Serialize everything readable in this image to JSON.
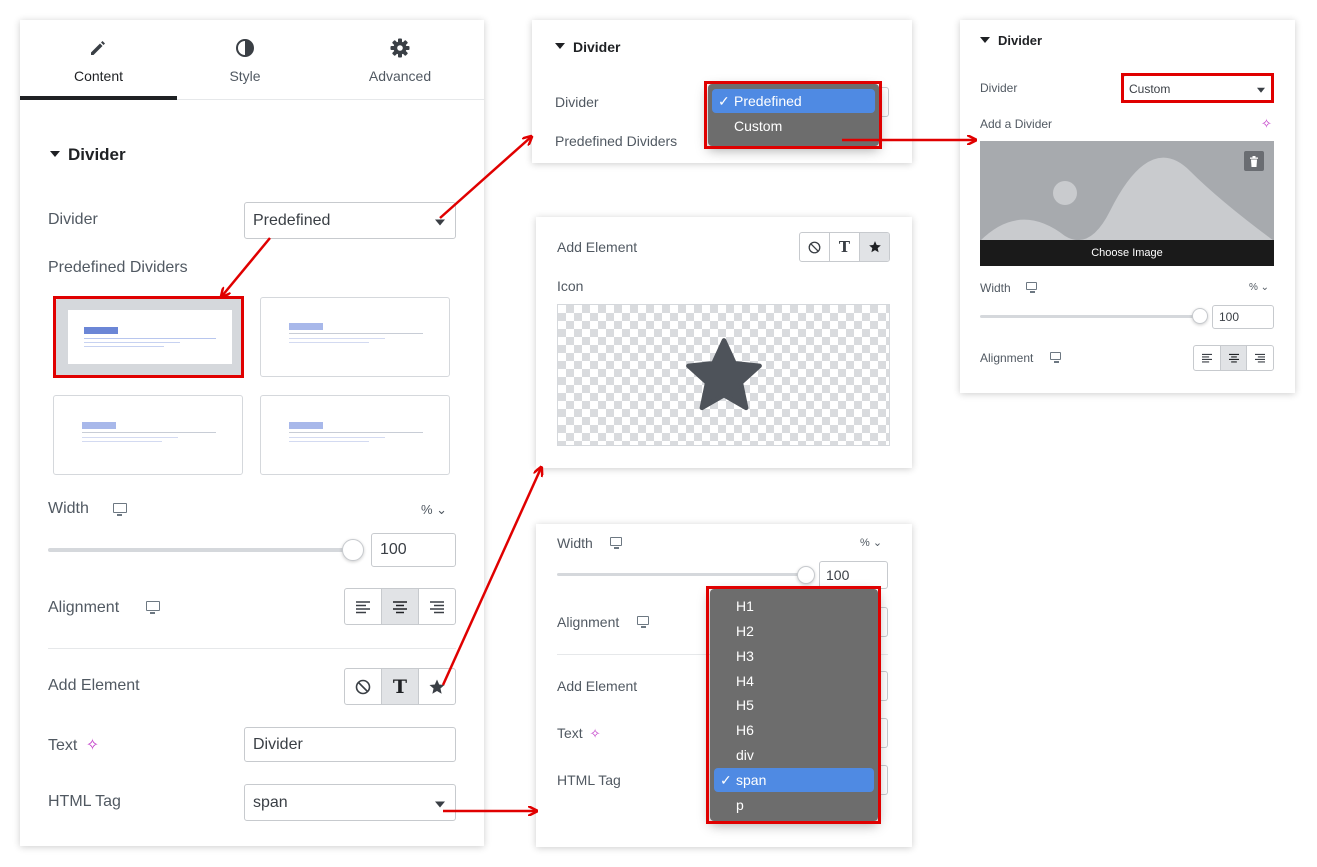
{
  "panel_main": {
    "tabs": [
      {
        "label": "Content",
        "icon": "pencil-icon",
        "active": true
      },
      {
        "label": "Style",
        "icon": "half-circle-icon",
        "active": false
      },
      {
        "label": "Advanced",
        "icon": "gear-icon",
        "active": false
      }
    ],
    "section_title": "Divider",
    "divider_label": "Divider",
    "divider_value": "Predefined",
    "predefined_label": "Predefined Dividers",
    "width_label": "Width",
    "width_unit": "%",
    "width_value": "100",
    "alignment_label": "Alignment",
    "alignment_active": "center",
    "add_element_label": "Add Element",
    "add_element_active": "text",
    "text_label": "Text",
    "text_value": "Divider",
    "html_tag_label": "HTML Tag",
    "html_tag_value": "span"
  },
  "panel_dropdown": {
    "section_title": "Divider",
    "divider_label": "Divider",
    "predefined_label": "Predefined Dividers",
    "options": [
      {
        "label": "Predefined",
        "selected": true
      },
      {
        "label": "Custom",
        "selected": false
      }
    ],
    "check": "✓"
  },
  "panel_custom": {
    "section_title": "Divider",
    "divider_label": "Divider",
    "divider_value": "Custom",
    "add_divider_label": "Add a Divider",
    "choose_image": "Choose Image",
    "width_label": "Width",
    "width_unit": "%",
    "width_value": "100",
    "alignment_label": "Alignment",
    "alignment_active": "center"
  },
  "panel_icon": {
    "add_element_label": "Add Element",
    "add_element_active": "icon",
    "icon_label": "Icon",
    "icon": "star-icon"
  },
  "panel_tag": {
    "width_label": "Width",
    "width_unit": "%",
    "width_value": "100",
    "alignment_label": "Alignment",
    "add_element_label": "Add Element",
    "text_label": "Text",
    "html_tag_label": "HTML Tag",
    "options": [
      {
        "label": "H1",
        "selected": false
      },
      {
        "label": "H2",
        "selected": false
      },
      {
        "label": "H3",
        "selected": false
      },
      {
        "label": "H4",
        "selected": false
      },
      {
        "label": "H5",
        "selected": false
      },
      {
        "label": "H6",
        "selected": false
      },
      {
        "label": "div",
        "selected": false
      },
      {
        "label": "span",
        "selected": true
      },
      {
        "label": "p",
        "selected": false
      }
    ],
    "check": "✓"
  },
  "colors": {
    "highlight_red": "#e00000",
    "menu_selected": "#4f8ae3",
    "menu_bg": "#6d6d6d",
    "sparkle": "#c13bc8",
    "thumb_accent": "#6b86d6"
  }
}
